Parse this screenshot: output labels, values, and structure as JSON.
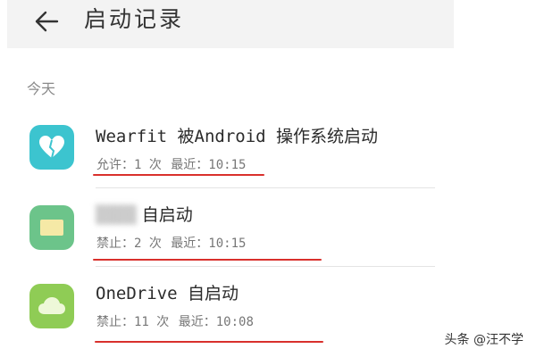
{
  "header": {
    "title": "启动记录"
  },
  "section_label": "今天",
  "items": [
    {
      "title": "Wearfit 被Android 操作系统启动",
      "status": "允许：1 次",
      "recent": "最近：10:15",
      "icon": "heart-app-icon",
      "icon_color": "#3cc4cf"
    },
    {
      "title_suffix": "自启动",
      "status": "禁止：2 次",
      "recent": "最近：10:15",
      "icon": "news-app-icon",
      "icon_color": "#6cc48a"
    },
    {
      "title": "OneDrive 自启动",
      "status": "禁止：11 次",
      "recent": "最近：10:08",
      "icon": "cloud-app-icon",
      "icon_color": "#8fcc55"
    }
  ],
  "watermark": "头条 @汪不学",
  "colors": {
    "annotation_red": "#d9302c",
    "header_bg": "#f3f3f3"
  }
}
